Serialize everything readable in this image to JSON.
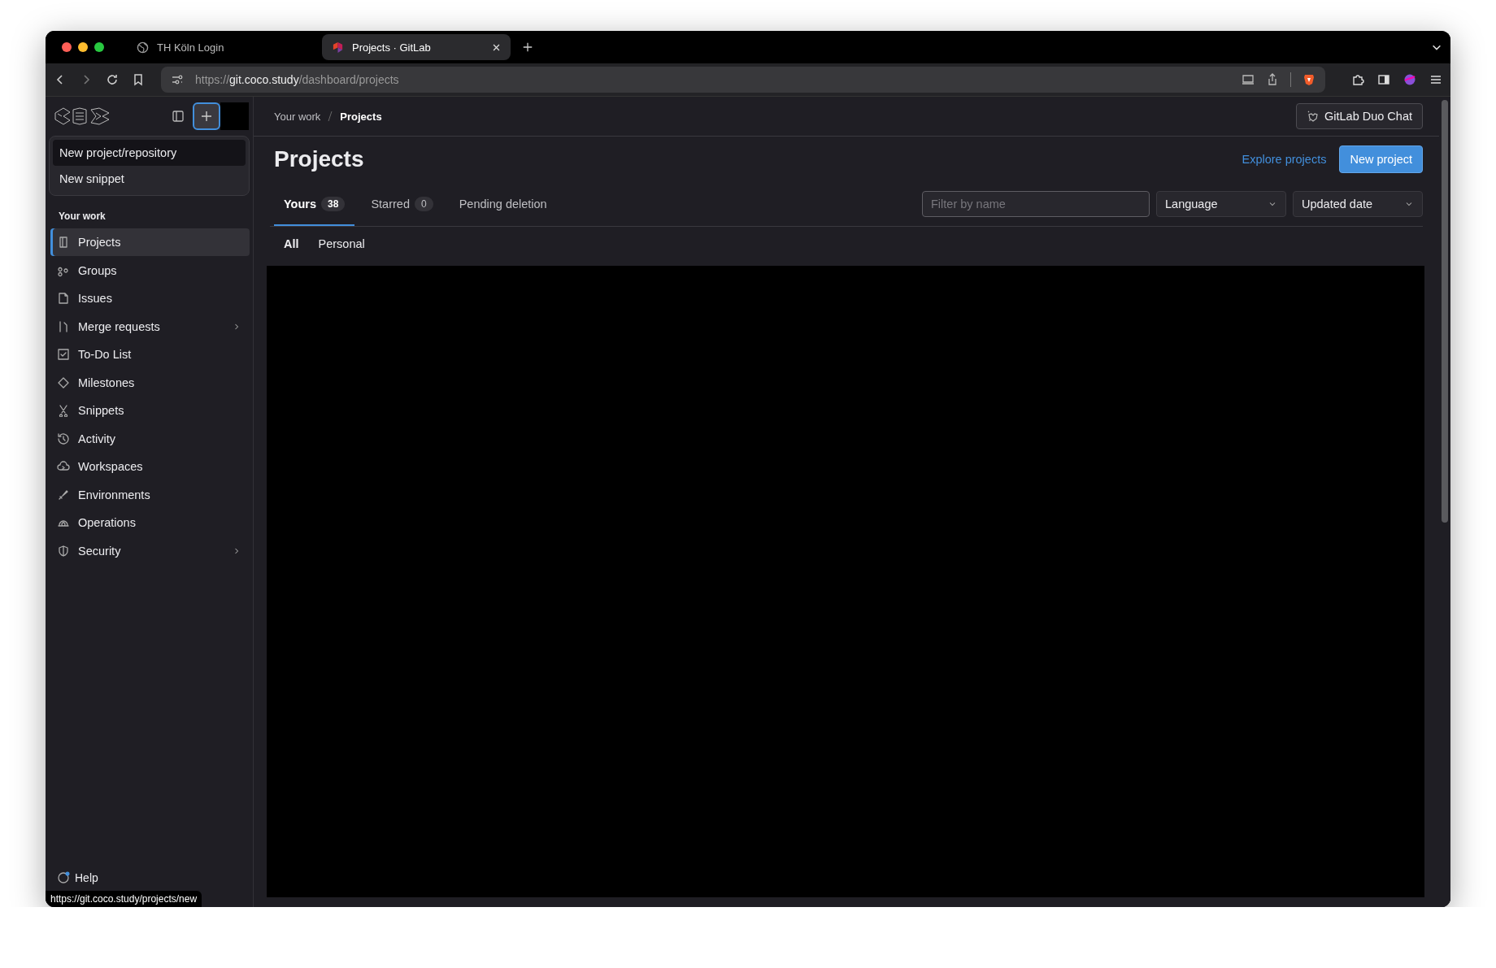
{
  "browser": {
    "tabs": [
      {
        "title": "TH Köln Login",
        "selected": false
      },
      {
        "title": "Projects · GitLab",
        "selected": true
      }
    ],
    "url": {
      "scheme": "https://",
      "host": "git.coco.study",
      "path": "/dashboard/projects"
    },
    "status_url": "https://git.coco.study/projects/new"
  },
  "sidebar": {
    "new_menu": [
      {
        "label": "New project/repository",
        "selected": true
      },
      {
        "label": "New snippet",
        "selected": false
      }
    ],
    "section_title": "Your work",
    "items": [
      {
        "label": "Projects",
        "selected": true,
        "has_submenu": false
      },
      {
        "label": "Groups",
        "selected": false,
        "has_submenu": false
      },
      {
        "label": "Issues",
        "selected": false,
        "has_submenu": false
      },
      {
        "label": "Merge requests",
        "selected": false,
        "has_submenu": true
      },
      {
        "label": "To-Do List",
        "selected": false,
        "has_submenu": false
      },
      {
        "label": "Milestones",
        "selected": false,
        "has_submenu": false
      },
      {
        "label": "Snippets",
        "selected": false,
        "has_submenu": false
      },
      {
        "label": "Activity",
        "selected": false,
        "has_submenu": false
      },
      {
        "label": "Workspaces",
        "selected": false,
        "has_submenu": false
      },
      {
        "label": "Environments",
        "selected": false,
        "has_submenu": false
      },
      {
        "label": "Operations",
        "selected": false,
        "has_submenu": false
      },
      {
        "label": "Security",
        "selected": false,
        "has_submenu": true
      }
    ],
    "help": "Help"
  },
  "breadcrumb": [
    "Your work",
    "Projects"
  ],
  "duo_chat": "GitLab Duo Chat",
  "title": "Projects",
  "explore_link": "Explore projects",
  "new_project": "New project",
  "tabs": [
    {
      "label": "Yours",
      "count": "38",
      "selected": true
    },
    {
      "label": "Starred",
      "count": "0",
      "selected": false
    },
    {
      "label": "Pending deletion",
      "selected": false
    }
  ],
  "filter": {
    "placeholder": "Filter by name"
  },
  "dropdowns": [
    "Language",
    "Updated date"
  ],
  "subtabs": [
    {
      "label": "All",
      "selected": true
    },
    {
      "label": "Personal",
      "selected": false
    }
  ]
}
